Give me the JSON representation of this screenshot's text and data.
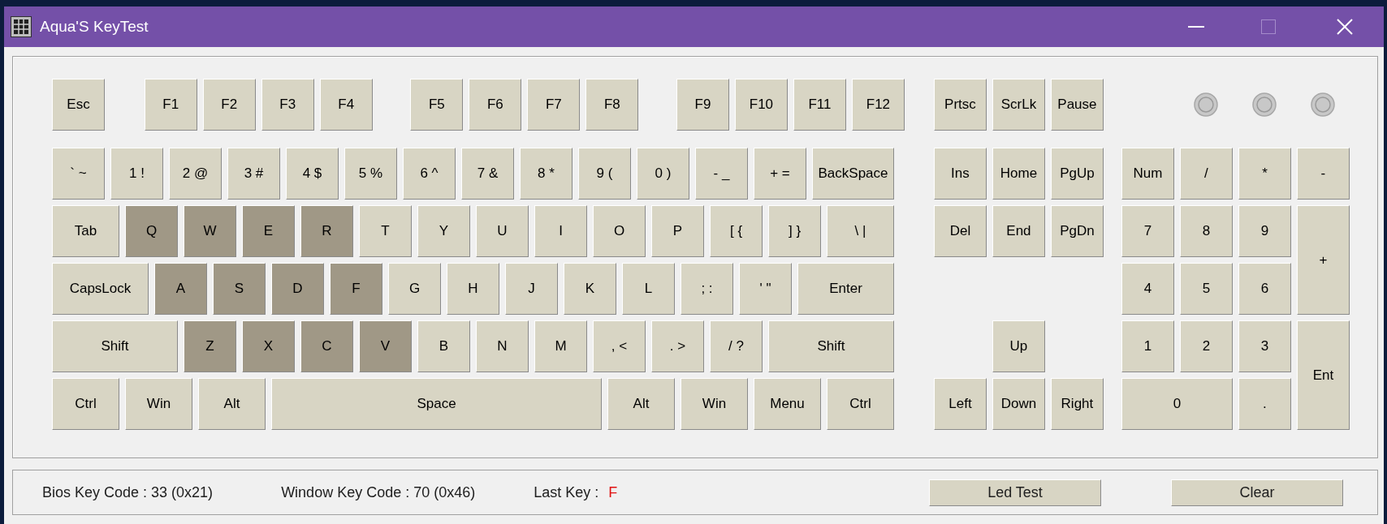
{
  "window": {
    "title": "Aqua'S KeyTest"
  },
  "keyboard": {
    "main_rows": [
      [
        {
          "label": "Esc",
          "pressed": false
        },
        {
          "label": "F1",
          "pressed": false
        },
        {
          "label": "F2",
          "pressed": false
        },
        {
          "label": "F3",
          "pressed": false
        },
        {
          "label": "F4",
          "pressed": false
        },
        {
          "label": "F5",
          "pressed": false
        },
        {
          "label": "F6",
          "pressed": false
        },
        {
          "label": "F7",
          "pressed": false
        },
        {
          "label": "F8",
          "pressed": false
        },
        {
          "label": "F9",
          "pressed": false
        },
        {
          "label": "F10",
          "pressed": false
        },
        {
          "label": "F11",
          "pressed": false
        },
        {
          "label": "F12",
          "pressed": false
        }
      ],
      [
        {
          "label": "` ~",
          "pressed": false
        },
        {
          "label": "1 !",
          "pressed": false
        },
        {
          "label": "2 @",
          "pressed": false
        },
        {
          "label": "3 #",
          "pressed": false
        },
        {
          "label": "4 $",
          "pressed": false
        },
        {
          "label": "5 %",
          "pressed": false
        },
        {
          "label": "6 ^",
          "pressed": false
        },
        {
          "label": "7 &",
          "pressed": false
        },
        {
          "label": "8 *",
          "pressed": false
        },
        {
          "label": "9 (",
          "pressed": false
        },
        {
          "label": "0 )",
          "pressed": false
        },
        {
          "label": "- _",
          "pressed": false
        },
        {
          "label": "+ =",
          "pressed": false
        },
        {
          "label": "BackSpace",
          "pressed": false
        }
      ],
      [
        {
          "label": "Tab",
          "pressed": false
        },
        {
          "label": "Q",
          "pressed": true
        },
        {
          "label": "W",
          "pressed": true
        },
        {
          "label": "E",
          "pressed": true
        },
        {
          "label": "R",
          "pressed": true
        },
        {
          "label": "T",
          "pressed": false
        },
        {
          "label": "Y",
          "pressed": false
        },
        {
          "label": "U",
          "pressed": false
        },
        {
          "label": "I",
          "pressed": false
        },
        {
          "label": "O",
          "pressed": false
        },
        {
          "label": "P",
          "pressed": false
        },
        {
          "label": "[ {",
          "pressed": false
        },
        {
          "label": "] }",
          "pressed": false
        },
        {
          "label": "\\ |",
          "pressed": false
        }
      ],
      [
        {
          "label": "CapsLock",
          "pressed": false
        },
        {
          "label": "A",
          "pressed": true
        },
        {
          "label": "S",
          "pressed": true
        },
        {
          "label": "D",
          "pressed": true
        },
        {
          "label": "F",
          "pressed": true
        },
        {
          "label": "G",
          "pressed": false
        },
        {
          "label": "H",
          "pressed": false
        },
        {
          "label": "J",
          "pressed": false
        },
        {
          "label": "K",
          "pressed": false
        },
        {
          "label": "L",
          "pressed": false
        },
        {
          "label": "; :",
          "pressed": false
        },
        {
          "label": "' \"",
          "pressed": false
        },
        {
          "label": "Enter",
          "pressed": false
        }
      ],
      [
        {
          "label": "Shift",
          "pressed": false
        },
        {
          "label": "Z",
          "pressed": true
        },
        {
          "label": "X",
          "pressed": true
        },
        {
          "label": "C",
          "pressed": true
        },
        {
          "label": "V",
          "pressed": true
        },
        {
          "label": "B",
          "pressed": false
        },
        {
          "label": "N",
          "pressed": false
        },
        {
          "label": "M",
          "pressed": false
        },
        {
          "label": ", <",
          "pressed": false
        },
        {
          "label": ". >",
          "pressed": false
        },
        {
          "label": "/ ?",
          "pressed": false
        },
        {
          "label": "Shift",
          "pressed": false
        }
      ],
      [
        {
          "label": "Ctrl",
          "pressed": false
        },
        {
          "label": "Win",
          "pressed": false
        },
        {
          "label": "Alt",
          "pressed": false
        },
        {
          "label": "Space",
          "pressed": false
        },
        {
          "label": "Alt",
          "pressed": false
        },
        {
          "label": "Win",
          "pressed": false
        },
        {
          "label": "Menu",
          "pressed": false
        },
        {
          "label": "Ctrl",
          "pressed": false
        }
      ]
    ],
    "nav_rows": [
      [
        {
          "label": "Prtsc",
          "pressed": false
        },
        {
          "label": "ScrLk",
          "pressed": false
        },
        {
          "label": "Pause",
          "pressed": false
        }
      ],
      [
        {
          "label": "Ins",
          "pressed": false
        },
        {
          "label": "Home",
          "pressed": false
        },
        {
          "label": "PgUp",
          "pressed": false
        }
      ],
      [
        {
          "label": "Del",
          "pressed": false
        },
        {
          "label": "End",
          "pressed": false
        },
        {
          "label": "PgDn",
          "pressed": false
        }
      ],
      [
        {
          "label": "Up",
          "pressed": false
        }
      ],
      [
        {
          "label": "Left",
          "pressed": false
        },
        {
          "label": "Down",
          "pressed": false
        },
        {
          "label": "Right",
          "pressed": false
        }
      ]
    ],
    "leds": [
      {
        "on": false
      },
      {
        "on": false
      },
      {
        "on": false
      }
    ],
    "numpad_rows": [
      [
        {
          "label": "Num",
          "pressed": false
        },
        {
          "label": "/",
          "pressed": false
        },
        {
          "label": "*",
          "pressed": false
        },
        {
          "label": "-",
          "pressed": false
        }
      ],
      [
        {
          "label": "7",
          "pressed": false
        },
        {
          "label": "8",
          "pressed": false
        },
        {
          "label": "9",
          "pressed": false
        },
        {
          "label": "+",
          "pressed": false
        }
      ],
      [
        {
          "label": "4",
          "pressed": false
        },
        {
          "label": "5",
          "pressed": false
        },
        {
          "label": "6",
          "pressed": false
        }
      ],
      [
        {
          "label": "1",
          "pressed": false
        },
        {
          "label": "2",
          "pressed": false
        },
        {
          "label": "3",
          "pressed": false
        },
        {
          "label": "Ent",
          "pressed": false
        }
      ],
      [
        {
          "label": "0",
          "pressed": false
        },
        {
          "label": ".",
          "pressed": false
        }
      ]
    ]
  },
  "status": {
    "bios_code": "Bios Key Code : 33 (0x21)",
    "window_code": "Window Key Code : 70 (0x46)",
    "last_key_label": "Last Key :",
    "last_key": "F"
  },
  "buttons": [
    "Led Test",
    "Clear"
  ]
}
